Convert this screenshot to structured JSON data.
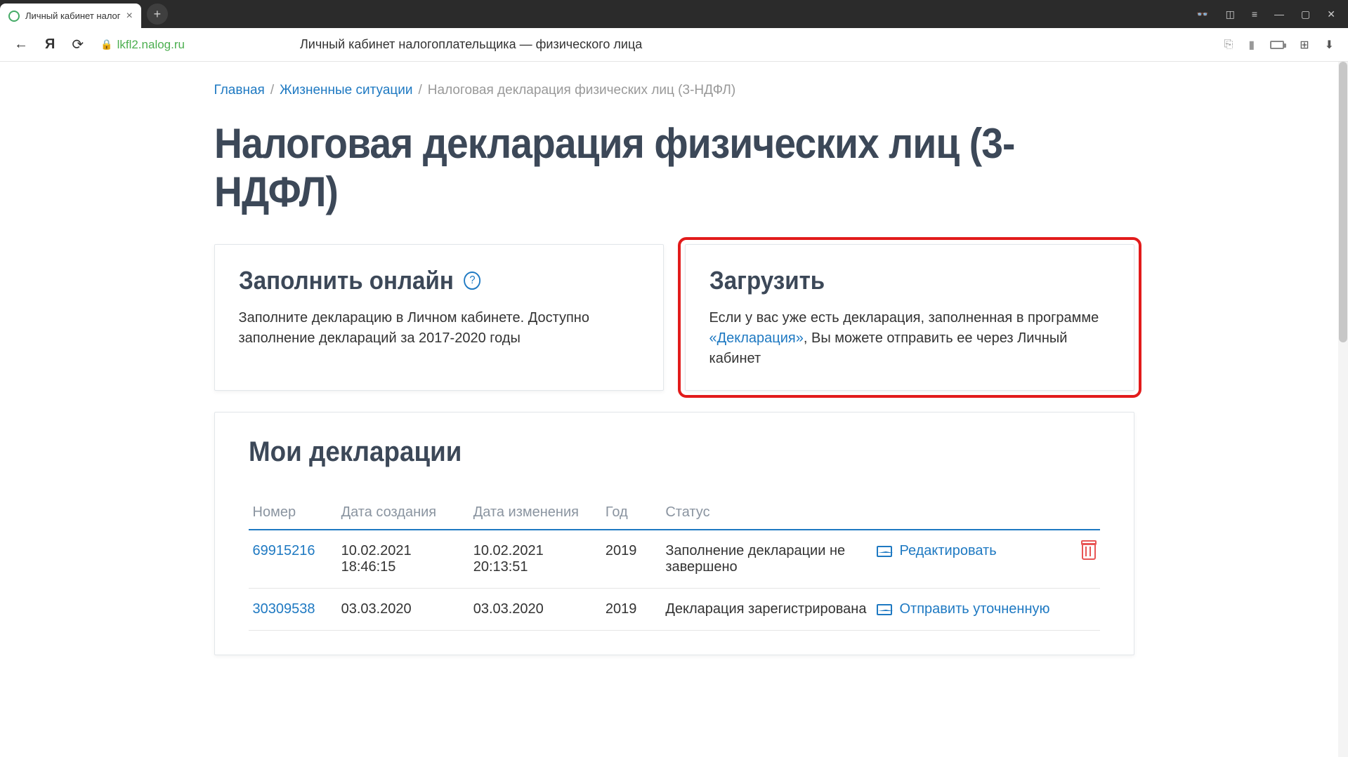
{
  "browser": {
    "tab_title": "Личный кабинет налог",
    "url": "lkfl2.nalog.ru",
    "page_title": "Личный кабинет налогоплательщика — физического лица"
  },
  "breadcrumb": {
    "home": "Главная",
    "situations": "Жизненные ситуации",
    "current": "Налоговая декларация физических лиц (3-НДФЛ)"
  },
  "heading": "Налоговая декларация физических лиц (3-НДФЛ)",
  "cards": {
    "fill": {
      "title": "Заполнить онлайн",
      "desc": "Заполните декларацию в Личном кабинете. Доступно заполнение деклараций за 2017-2020 годы"
    },
    "upload": {
      "title": "Загрузить",
      "desc_pre": "Если у вас уже есть декларация, заполненная в программе ",
      "desc_link": "«Декларация»",
      "desc_post": ", Вы можете отправить ее через Личный кабинет"
    }
  },
  "declarations": {
    "heading": "Мои декларации",
    "columns": {
      "number": "Номер",
      "created": "Дата создания",
      "modified": "Дата изменения",
      "year": "Год",
      "status": "Статус"
    },
    "rows": [
      {
        "number": "69915216",
        "created": "10.02.2021 18:46:15",
        "modified": "10.02.2021 20:13:51",
        "year": "2019",
        "status": "Заполнение декларации не завершено",
        "action": "Редактировать"
      },
      {
        "number": "30309538",
        "created": "03.03.2020",
        "modified": "03.03.2020",
        "year": "2019",
        "status": "Декларация зарегистрирована",
        "action": "Отправить уточненную"
      }
    ]
  }
}
